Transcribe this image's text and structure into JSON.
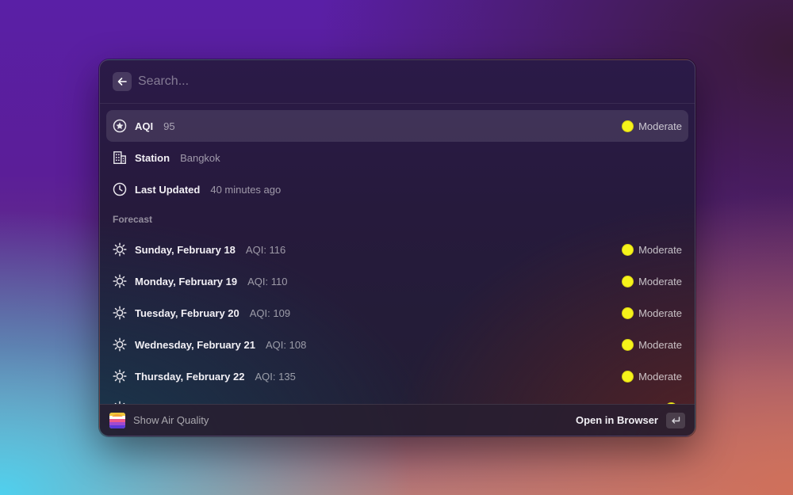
{
  "search": {
    "placeholder": "Search..."
  },
  "items": [
    {
      "title": "AQI",
      "subtitle": "95",
      "status": "Moderate",
      "icon": "star-circle-icon"
    },
    {
      "title": "Station",
      "subtitle": "Bangkok",
      "icon": "building-icon"
    },
    {
      "title": "Last Updated",
      "subtitle": "40 minutes ago",
      "icon": "clock-icon"
    }
  ],
  "forecast": {
    "header": "Forecast",
    "days": [
      {
        "title": "Sunday, February 18",
        "subtitle": "AQI: 116",
        "status": "Moderate",
        "icon": "sun-icon"
      },
      {
        "title": "Monday, February 19",
        "subtitle": "AQI: 110",
        "status": "Moderate",
        "icon": "sun-icon"
      },
      {
        "title": "Tuesday, February 20",
        "subtitle": "AQI: 109",
        "status": "Moderate",
        "icon": "sun-icon"
      },
      {
        "title": "Wednesday, February 21",
        "subtitle": "AQI: 108",
        "status": "Moderate",
        "icon": "sun-icon"
      },
      {
        "title": "Thursday, February 22",
        "subtitle": "AQI: 135",
        "status": "Moderate",
        "icon": "sun-icon"
      }
    ]
  },
  "footer": {
    "app_name": "Show Air Quality",
    "primary_action": "Open in Browser",
    "shortcut_icon": "return-key-icon"
  },
  "colors": {
    "moderate": "#f5f31a"
  }
}
